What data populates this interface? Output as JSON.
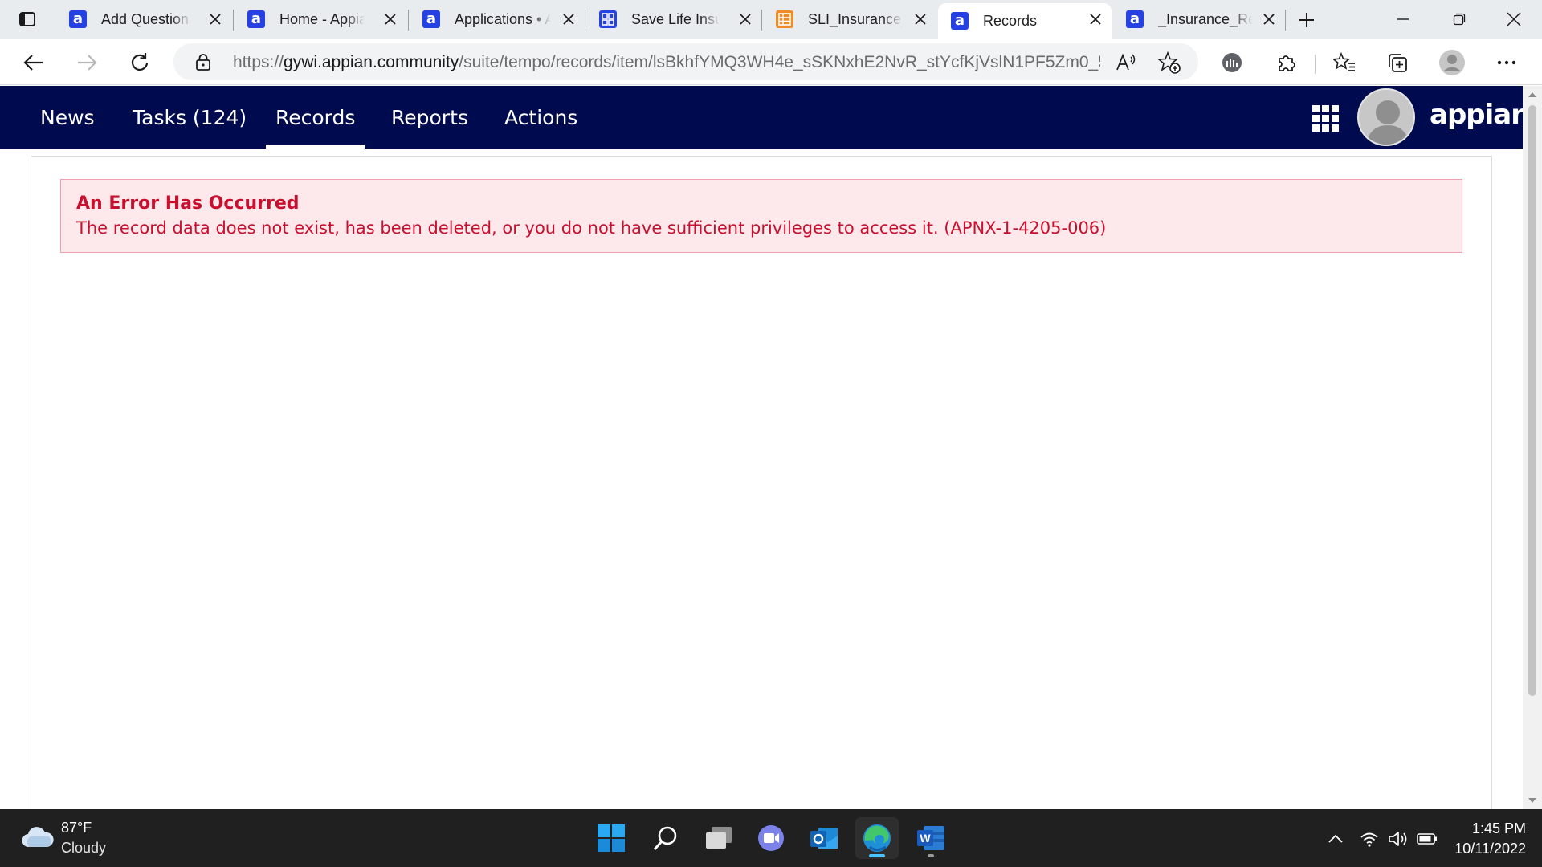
{
  "browser": {
    "tabs": [
      {
        "title": "Add Question",
        "favicon": "appian-icon",
        "active": false
      },
      {
        "title": "Home - Appian",
        "favicon": "appian-icon",
        "active": false
      },
      {
        "title": "Applications • Appian",
        "favicon": "appian-icon",
        "active": false
      },
      {
        "title": "Save Life Insurance",
        "favicon": "grid-app-icon",
        "active": false
      },
      {
        "title": "SLI_Insurance_Records",
        "favicon": "spreadsheet-icon",
        "active": false
      },
      {
        "title": "Records",
        "favicon": "appian-icon",
        "active": true
      },
      {
        "title": "_Insurance_Records",
        "favicon": "appian-icon",
        "active": false
      }
    ],
    "address": {
      "scheme": "https://",
      "host": "gywi.appian.community",
      "path": "/suite/tempo/records/item/lsBkhfYMQ3WH4e_sSKNxhE2NvR_stYcfKjVslN1PF5Zm0_5..."
    }
  },
  "appian": {
    "nav": [
      {
        "label": "News",
        "active": false
      },
      {
        "label": "Tasks (124)",
        "active": false
      },
      {
        "label": "Records",
        "active": true
      },
      {
        "label": "Reports",
        "active": false
      },
      {
        "label": "Actions",
        "active": false
      }
    ],
    "brand": "appian",
    "navbar_color": "#000b4f"
  },
  "error": {
    "title": "An Error Has Occurred",
    "message": "The record data does not exist, has been deleted, or you do not have sufficient privileges to access it. (APNX-1-4205-006)",
    "color": "#c8102e",
    "background": "#fde8ec"
  },
  "taskbar": {
    "weather": {
      "temp": "87°F",
      "condition": "Cloudy",
      "icon": "cloud-icon"
    },
    "apps": [
      "start-icon",
      "search-icon",
      "task-view-icon",
      "teams-chat-icon",
      "outlook-icon",
      "edge-icon",
      "word-icon"
    ],
    "clock": {
      "time": "1:45 PM",
      "date": "10/11/2022"
    }
  }
}
